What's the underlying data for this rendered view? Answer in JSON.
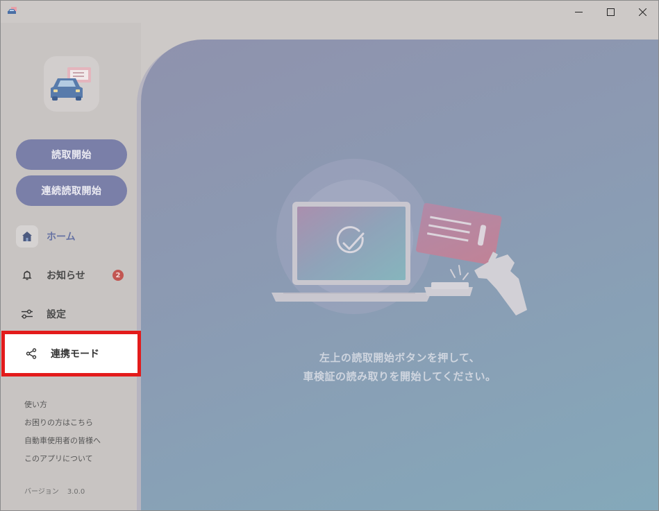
{
  "titlebar": {
    "minimize_glyph": "—",
    "maximize_glyph": "☐",
    "close_glyph": "✕"
  },
  "sidebar": {
    "read_button": "読取開始",
    "continuous_button": "連続読取開始",
    "nav": {
      "home": "ホーム",
      "news": "お知らせ",
      "news_badge": "2",
      "settings": "設定",
      "link_mode": "連携モード"
    },
    "links": [
      "使い方",
      "お困りの方はこちら",
      "自動車使用者の皆様へ",
      "このアプリについて"
    ],
    "version_label": "バージョン",
    "version_number": "3.0.0"
  },
  "main": {
    "line1": "左上の読取開始ボタンを押して、",
    "line2": "車検証の読み取りを開始してください。"
  },
  "colors": {
    "accent": "#7a7fa8",
    "highlight": "#e31b1b",
    "badge": "#c25652",
    "main_gradient_start": "#8f92ad",
    "main_gradient_end": "#84a9ba"
  },
  "icons": [
    "app-icon",
    "car-logo-icon",
    "home-icon",
    "bell-icon",
    "sliders-icon",
    "share-icon",
    "laptop-icon",
    "check-circle-icon",
    "card-icon",
    "hand-icon"
  ]
}
